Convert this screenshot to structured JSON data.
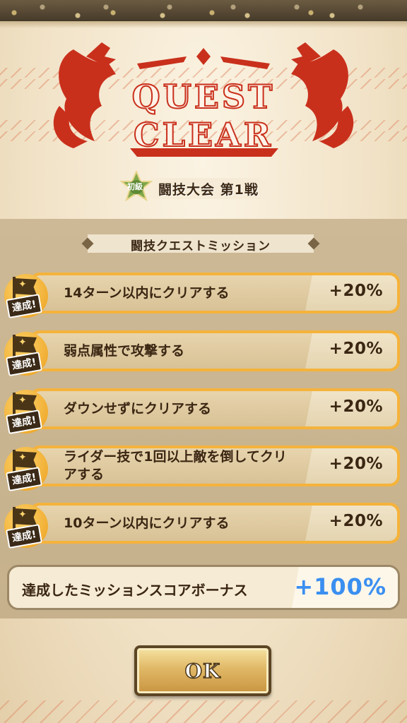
{
  "logo": {
    "line1": "QUEST",
    "line2": "CLEAR"
  },
  "stage": {
    "badge_label": "初級",
    "title": "闘技大会 第1戦"
  },
  "missions_header": "闘技クエストミッション",
  "achieved_label": "達成!",
  "missions": [
    {
      "text": "14ターン以内にクリアする",
      "bonus": "+20%"
    },
    {
      "text": "弱点属性で攻撃する",
      "bonus": "+20%"
    },
    {
      "text": "ダウンせずにクリアする",
      "bonus": "+20%"
    },
    {
      "text": "ライダー技で1回以上敵を倒してクリアする",
      "bonus": "+20%"
    },
    {
      "text": "10ターン以内にクリアする",
      "bonus": "+20%"
    }
  ],
  "bonus": {
    "label": "達成したミッションスコアボーナス",
    "value": "+100%"
  },
  "ok_button": "OK",
  "colors": {
    "accent_red": "#c9301c",
    "bonus_blue": "#3a8ff0",
    "achieve_orange": "#f5b33b"
  }
}
